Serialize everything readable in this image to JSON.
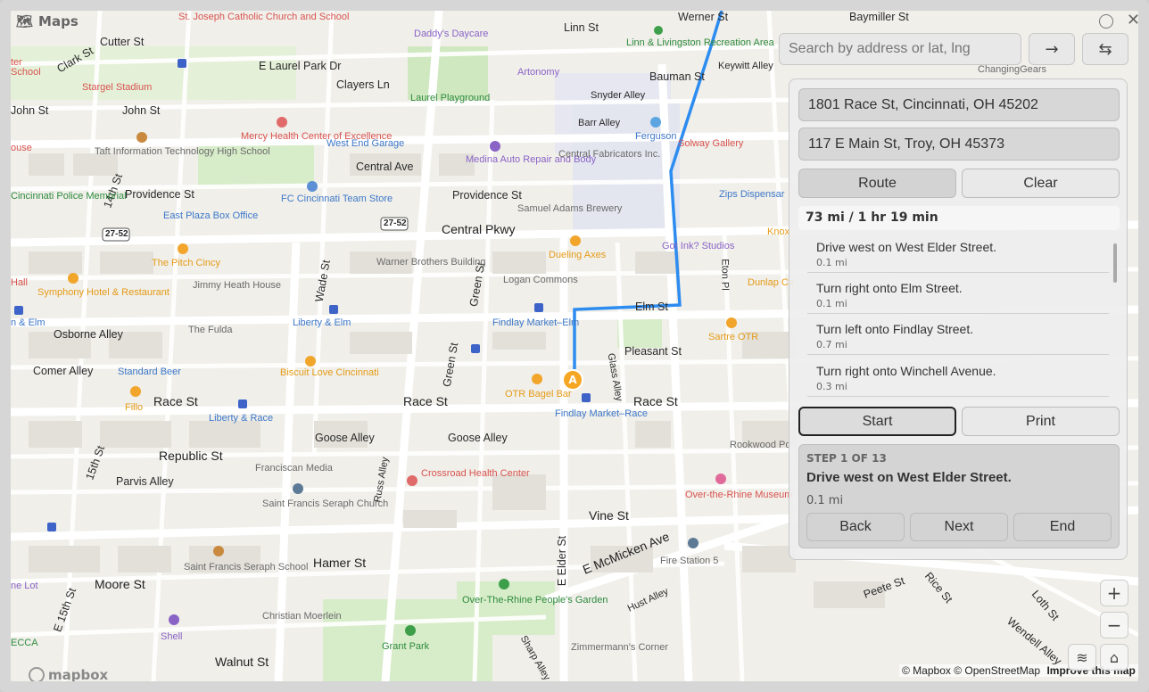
{
  "app": {
    "title": "Maps"
  },
  "search": {
    "placeholder": "Search by address or lat, lng"
  },
  "directions": {
    "origin": "1801 Race St, Cincinnati, OH 45202",
    "destination": "117 E Main St, Troy, OH 45373",
    "route_label": "Route",
    "clear_label": "Clear",
    "summary": "73 mi / 1 hr 19 min",
    "steps": [
      {
        "text": "Drive west on West Elder Street.",
        "distance": "0.1 mi"
      },
      {
        "text": "Turn right onto Elm Street.",
        "distance": "0.1 mi"
      },
      {
        "text": "Turn left onto Findlay Street.",
        "distance": "0.7 mi"
      },
      {
        "text": "Turn right onto Winchell Avenue.",
        "distance": "0.3 mi"
      }
    ],
    "start_label": "Start",
    "print_label": "Print"
  },
  "step_card": {
    "header": "STEP 1 OF 13",
    "title": "Drive west on West Elder Street.",
    "distance": "0.1 mi",
    "back_label": "Back",
    "next_label": "Next",
    "end_label": "End"
  },
  "map": {
    "route_color": "#2d8cf0",
    "marker_label": "A",
    "attribution": "© Mapbox © OpenStreetMap",
    "improve": "Improve this map",
    "brand": "mapbox",
    "labels": {
      "werner": "Werner St",
      "linn": "Linn St",
      "baymiller": "Baymiller St",
      "cutter": "Cutter St",
      "clark": "Clark St",
      "elarkpark": "E Laurel Park Dr",
      "clayers": "Clayers Ln",
      "johnst": "John St",
      "johnst2": "John St",
      "bauman": "Bauman St",
      "keywitt": "Keywitt Alley",
      "snyder": "Snyder Alley",
      "barr": "Barr Alley",
      "providence": "Providence St",
      "providence2": "Providence St",
      "centralave": "Central Ave",
      "centralpkwy": "Central Pkwy",
      "elm": "Elm St",
      "pleasant": "Pleasant St",
      "race": "Race St",
      "race2": "Race St",
      "race3": "Race St",
      "goose": "Goose Alley",
      "goose2": "Goose Alley",
      "republic": "Republic St",
      "parvis": "Parvis Alley",
      "vine": "Vine St",
      "hamer": "Hamer St",
      "moore": "Moore St",
      "walnut": "Walnut St",
      "emcmicken": "E McMicken Ave",
      "osborne": "Osborne Alley",
      "comer": "Comer Alley",
      "green": "Green St",
      "green2": "Green St",
      "wade": "Wade St",
      "elder": "E Elder St",
      "glass": "Glass Alley",
      "russ": "Russ Alley",
      "eton": "Eton Pl",
      "fifteenth": "15th St",
      "efifteenth": "E 15th St",
      "fourteenth": "14th St",
      "hust": "Hust Alley",
      "sharp": "Sharp Alley",
      "peete": "Peete St",
      "rice": "Rice St",
      "lothst": "Loth St",
      "wendell": "Wendell Alley",
      "rt2752": "27-52",
      "rt2752b": "27-52",
      "stjoseph": "St. Joseph Catholic Church and School",
      "daddys": "Daddy's Daycare",
      "linnliv": "Linn & Livingston Recreation Area",
      "artonomy": "Artonomy",
      "laurel": "Laurel Playground",
      "stargel": "Stargel Stadium",
      "mercy": "Mercy Health Center of Excellence",
      "westend": "West End Garage",
      "taft": "Taft Information Technology High School",
      "medina": "Medina Auto Repair and Body",
      "central_fab": "Central Fabricators Inc.",
      "ferguson": "Ferguson",
      "solway": "Solway Gallery",
      "cincipolice": "Cincinnati Police Memorial",
      "fcstore": "FC Cincinnati Team Store",
      "eastplaza": "East Plaza Box Office",
      "samadams": "Samuel Adams Brewery",
      "zips": "Zips Dispensar",
      "pitch": "The Pitch Cincy",
      "warner": "Warner Brothers Building",
      "dueling": "Dueling Axes",
      "gotink": "Got Ink? Studios",
      "knox": "Knox",
      "symphony": "Symphony Hotel & Restaurant",
      "jimmy": "Jimmy Heath House",
      "logan": "Logan Commons",
      "dunlap": "Dunlap Ca",
      "thefulda": "The Fulda",
      "libelm": "Liberty & Elm",
      "findlaymkt": "Findlay Market–Elm",
      "sartre": "Sartre OTR",
      "standardbeer": "Standard Beer",
      "biscuit": "Biscuit Love Cincinnati",
      "otrbagel": "OTR Bagel Bar",
      "fillo": "Fillo",
      "librace": "Liberty & Race",
      "findlayrace": "Findlay Market–Race",
      "rookwood": "Rookwood Po",
      "franciscan": "Franciscan Media",
      "crossroad": "Crossroad Health Center",
      "saintfrancisseraph": "Saint Francis Seraph Church",
      "otrmuseum": "Over-the-Rhine Museum",
      "firestation": "Fire Station 5",
      "sfschool": "Saint Francis Seraph School",
      "otrgarden": "Over-The-Rhine People's Garden",
      "christian": "Christian Moerlein",
      "shell": "Shell",
      "grantpark": "Grant Park",
      "zimmermann": "Zimmermann's Corner",
      "changing": "ChangingGears",
      "hall": "Hall",
      "elm_partial": "n & Elm",
      "nelot": "ne Lot",
      "ecca": "ECCA",
      "ouse": "ouse",
      "ter": "ter",
      "school": "School"
    }
  }
}
